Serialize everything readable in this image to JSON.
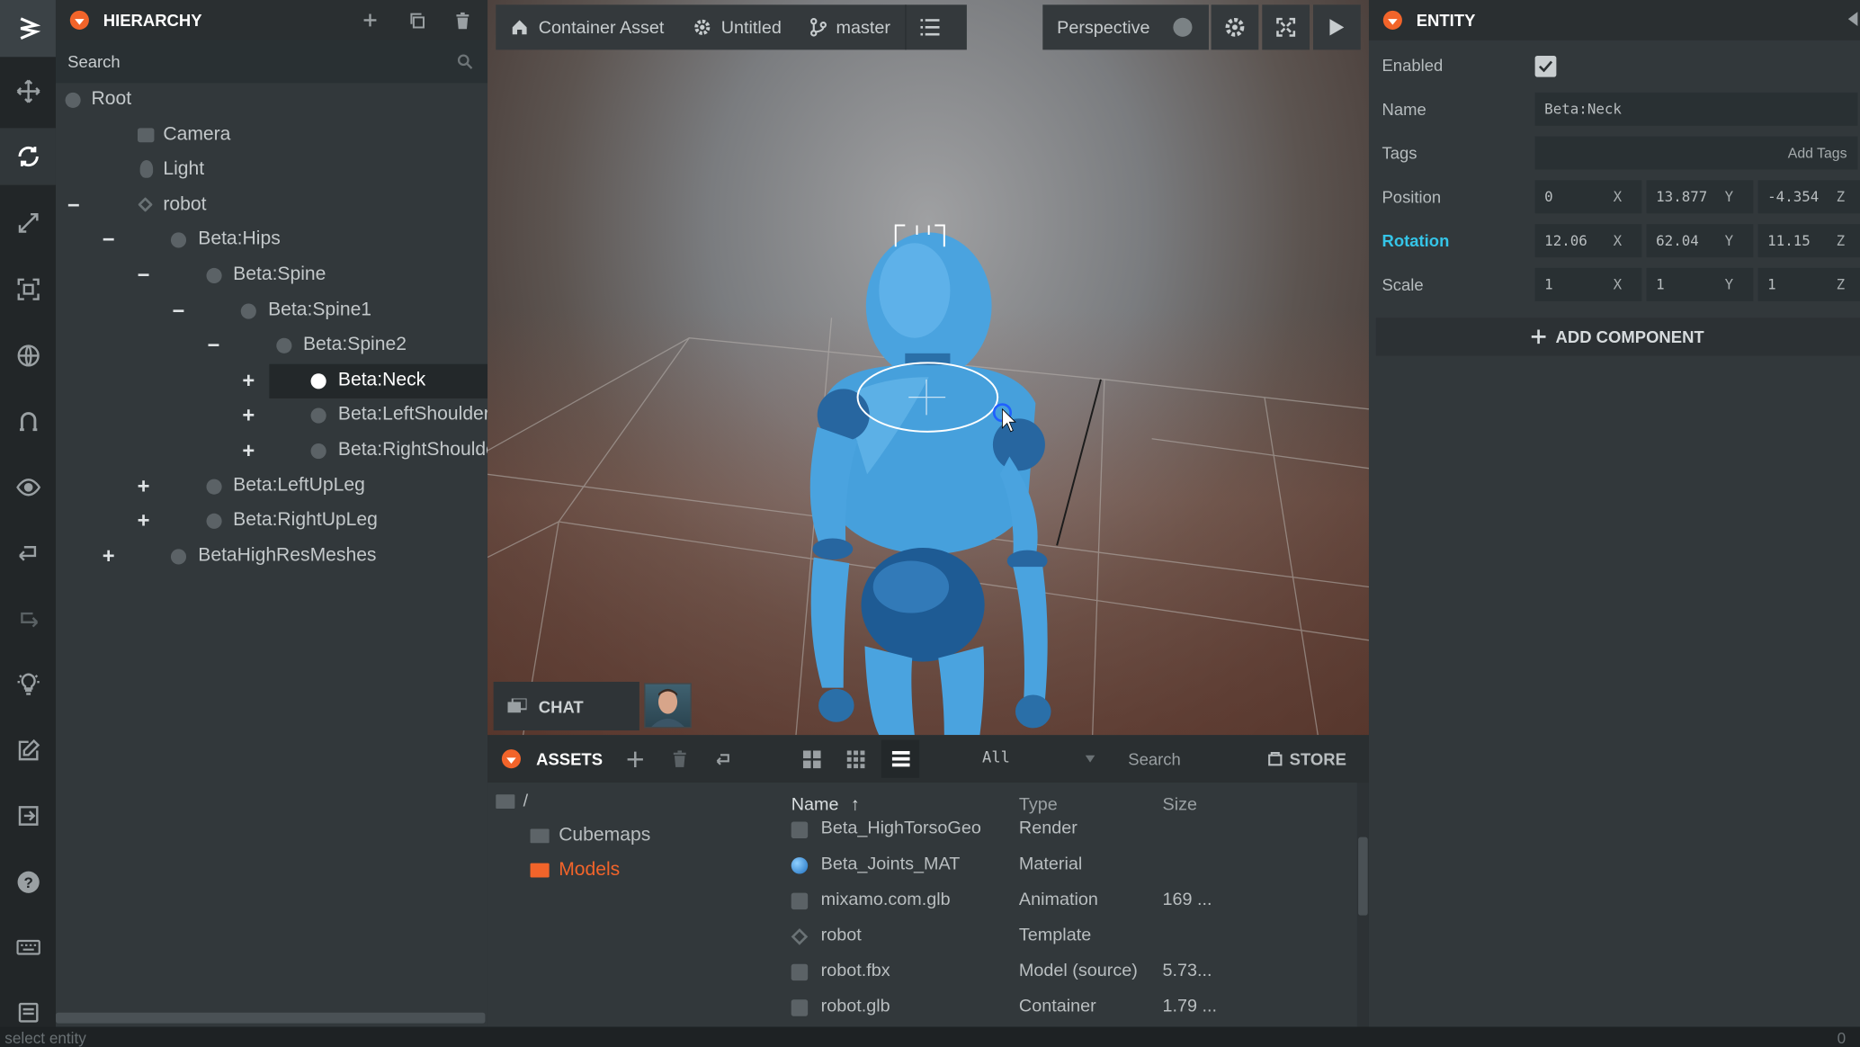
{
  "hierarchy": {
    "title": "HIERARCHY",
    "search_placeholder": "Search",
    "nodes": [
      {
        "label": "Root",
        "toggle": ""
      },
      {
        "label": "Camera",
        "toggle": ""
      },
      {
        "label": "Light",
        "toggle": ""
      },
      {
        "label": "robot",
        "toggle": "−"
      },
      {
        "label": "Beta:Hips",
        "toggle": "−"
      },
      {
        "label": "Beta:Spine",
        "toggle": "−"
      },
      {
        "label": "Beta:Spine1",
        "toggle": "−"
      },
      {
        "label": "Beta:Spine2",
        "toggle": "−"
      },
      {
        "label": "Beta:Neck",
        "toggle": "+"
      },
      {
        "label": "Beta:LeftShoulder",
        "toggle": "+"
      },
      {
        "label": "Beta:RightShoulder",
        "toggle": "+"
      },
      {
        "label": "Beta:LeftUpLeg",
        "toggle": "+"
      },
      {
        "label": "Beta:RightUpLeg",
        "toggle": "+"
      },
      {
        "label": "BetaHighResMeshes",
        "toggle": "+"
      }
    ],
    "selected": "Beta:Neck"
  },
  "viewport": {
    "project": "Container Asset",
    "scene": "Untitled",
    "branch": "master",
    "camera": "Perspective"
  },
  "chat": {
    "label": "CHAT"
  },
  "assets": {
    "title": "ASSETS",
    "filter": "All",
    "search_placeholder": "Search",
    "store_label": "STORE",
    "root_folder": "/",
    "folders": [
      "Cubemaps",
      "Models"
    ],
    "active_folder": "Models",
    "columns": {
      "name": "Name",
      "type": "Type",
      "size": "Size"
    },
    "rows": [
      {
        "name": "Beta_HighTorsoGeo",
        "type": "Render",
        "size": ""
      },
      {
        "name": "Beta_Joints_MAT",
        "type": "Material",
        "size": ""
      },
      {
        "name": "mixamo.com.glb",
        "type": "Animation",
        "size": "169 ..."
      },
      {
        "name": "robot",
        "type": "Template",
        "size": ""
      },
      {
        "name": "robot.fbx",
        "type": "Model (source)",
        "size": "5.73..."
      },
      {
        "name": "robot.glb",
        "type": "Container",
        "size": "1.79 ..."
      }
    ]
  },
  "entity": {
    "title": "ENTITY",
    "enabled_label": "Enabled",
    "enabled": true,
    "name_label": "Name",
    "name_value": "Beta:Neck",
    "tags_label": "Tags",
    "tags_placeholder": "Add Tags",
    "position_label": "Position",
    "position": {
      "x": "0",
      "y": "13.877",
      "z": "-4.354"
    },
    "rotation_label": "Rotation",
    "rotation": {
      "x": "12.06",
      "y": "62.04",
      "z": "11.15"
    },
    "scale_label": "Scale",
    "scale": {
      "x": "1",
      "y": "1",
      "z": "1"
    },
    "axes": {
      "x": "X",
      "y": "Y",
      "z": "Z"
    },
    "add_component": "ADD COMPONENT",
    "accent_color": "#35c5e8"
  },
  "status": {
    "text": "select entity",
    "right": "0"
  },
  "colors": {
    "orange": "#f2642a",
    "robot_blue": "#3f9bd8"
  }
}
